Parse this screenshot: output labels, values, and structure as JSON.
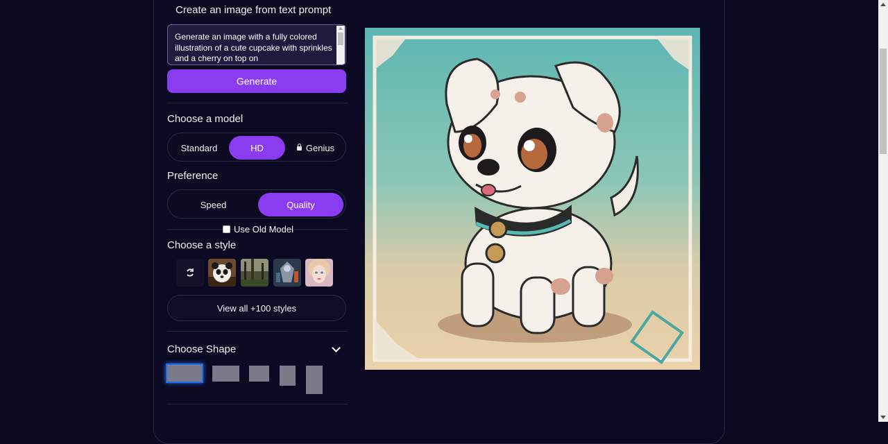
{
  "panel": {
    "title": "Create an image from text prompt",
    "prompt_value": "Generate an image with a fully colored illustration of a cute cupcake with sprinkles and a cherry on top on",
    "generate_label": "Generate"
  },
  "model": {
    "label": "Choose a model",
    "options": [
      "Standard",
      "HD",
      "Genius"
    ],
    "selected": "HD",
    "locked": [
      "Genius"
    ]
  },
  "preference": {
    "label": "Preference",
    "options": [
      "Speed",
      "Quality"
    ],
    "selected": "Quality",
    "old_model_label": "Use Old Model"
  },
  "style": {
    "label": "Choose a style",
    "thumbnails": [
      "reset-icon",
      "panda",
      "forest",
      "robot-warrior",
      "fantasy-girl"
    ],
    "view_all_label": "View all +100 styles"
  },
  "shape": {
    "label": "Choose Shape",
    "options": [
      "landscape-wide",
      "landscape",
      "square",
      "portrait",
      "portrait-tall"
    ],
    "selected": "landscape-wide"
  },
  "colors": {
    "accent": "#8a3cf0",
    "background": "#0b0920",
    "selected_outline": "#1e6ee8"
  },
  "result": {
    "subject": "puppy-illustration"
  }
}
